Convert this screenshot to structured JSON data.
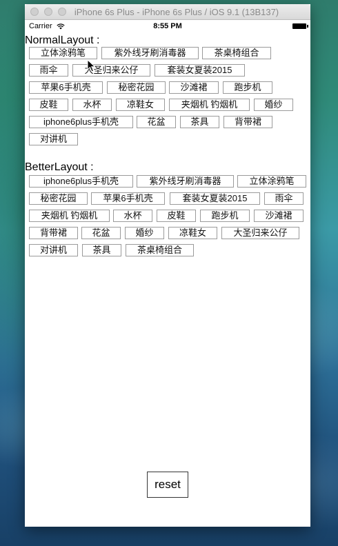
{
  "window": {
    "title": "iPhone 6s Plus - iPhone 6s Plus / iOS 9.1 (13B137)"
  },
  "status_bar": {
    "carrier": "Carrier",
    "time": "8:55 PM",
    "wifi_icon": "wifi-icon",
    "battery_icon": "battery-icon"
  },
  "normal_layout": {
    "title": "NormalLayout :",
    "tags": [
      "立体涂鸦笔",
      "紫外线牙刷消毒器",
      "茶桌椅组合",
      "雨伞",
      "大圣归来公仔",
      "套装女夏装2015",
      "苹果6手机壳",
      "秘密花园",
      "沙滩裙",
      "跑步机",
      "皮鞋",
      "水杯",
      "凉鞋女",
      "夹烟机 钓烟机",
      "婚纱",
      "iphone6plus手机壳",
      "花盆",
      "茶具",
      "背带裙",
      "对讲机"
    ]
  },
  "better_layout": {
    "title": "BetterLayout :",
    "tags": [
      "iphone6plus手机壳",
      "紫外线牙刷消毒器",
      "立体涂鸦笔",
      "秘密花园",
      "苹果6手机壳",
      "套装女夏装2015",
      "雨伞",
      "夹烟机 钓烟机",
      "水杯",
      "皮鞋",
      "跑步机",
      "沙滩裙",
      "背带裙",
      "花盆",
      "婚纱",
      "凉鞋女",
      "大圣归来公仔",
      "对讲机",
      "茶具",
      "茶桌椅组合"
    ]
  },
  "reset_label": "reset",
  "colors": {
    "tag_border": "#9a9a9a",
    "button_border": "#333333"
  }
}
